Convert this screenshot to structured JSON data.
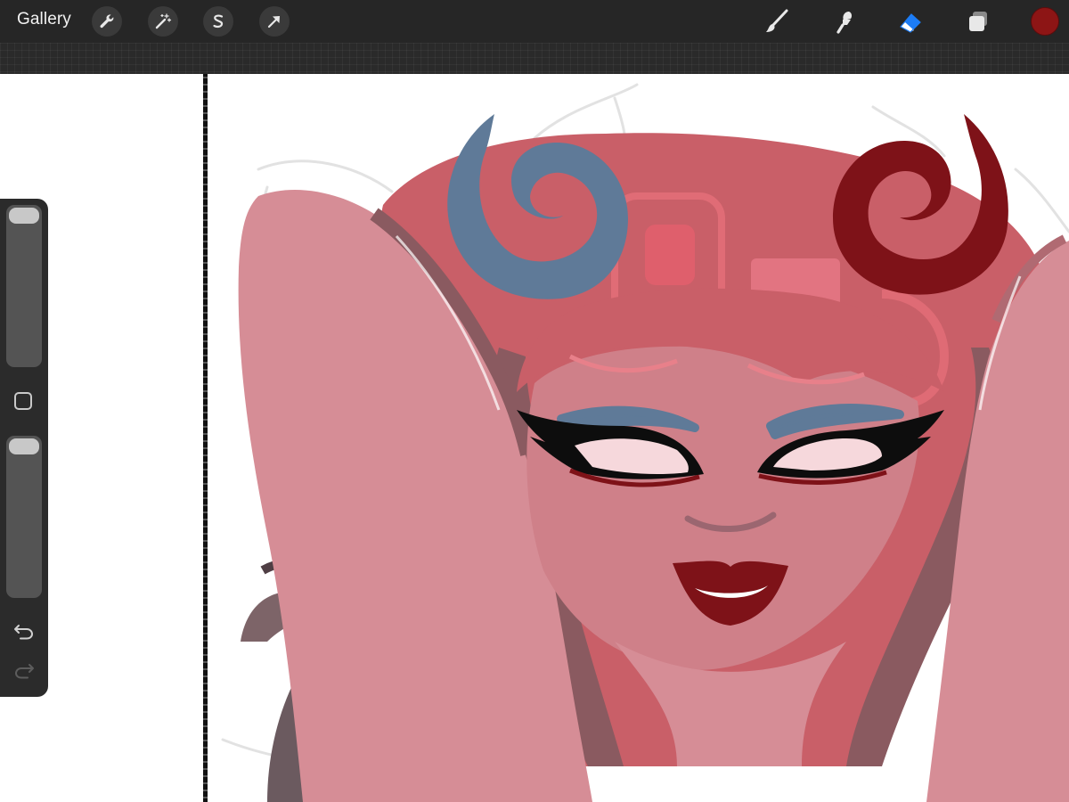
{
  "toolbar": {
    "gallery_label": "Gallery",
    "left_tools": [
      {
        "name": "actions-wrench-icon"
      },
      {
        "name": "adjustments-magic-wand-icon"
      },
      {
        "name": "selection-s-icon"
      },
      {
        "name": "transform-arrow-icon"
      }
    ],
    "right_tools": [
      {
        "name": "brush-icon"
      },
      {
        "name": "smudge-icon"
      },
      {
        "name": "eraser-icon",
        "active": true
      },
      {
        "name": "layers-icon"
      }
    ],
    "current_color": "#8d1515",
    "active_tool_color": "#1c7cf5"
  },
  "sidebar": {
    "brush_size_level": 0.0,
    "opacity_level": 0.0,
    "modify_button": "modify-square-icon",
    "undo": "undo-arrow-icon",
    "redo": "redo-arrow-icon"
  },
  "canvas": {
    "artwork": "character-illustration",
    "palette": {
      "skin": "#d68d96",
      "hair": "#c95f68",
      "hair_dark": "#8a5a60",
      "horn_left": "#5f7a98",
      "horn_right": "#7e1218",
      "lips": "#7e1218",
      "eyeshadow": "#5f7a98"
    }
  }
}
